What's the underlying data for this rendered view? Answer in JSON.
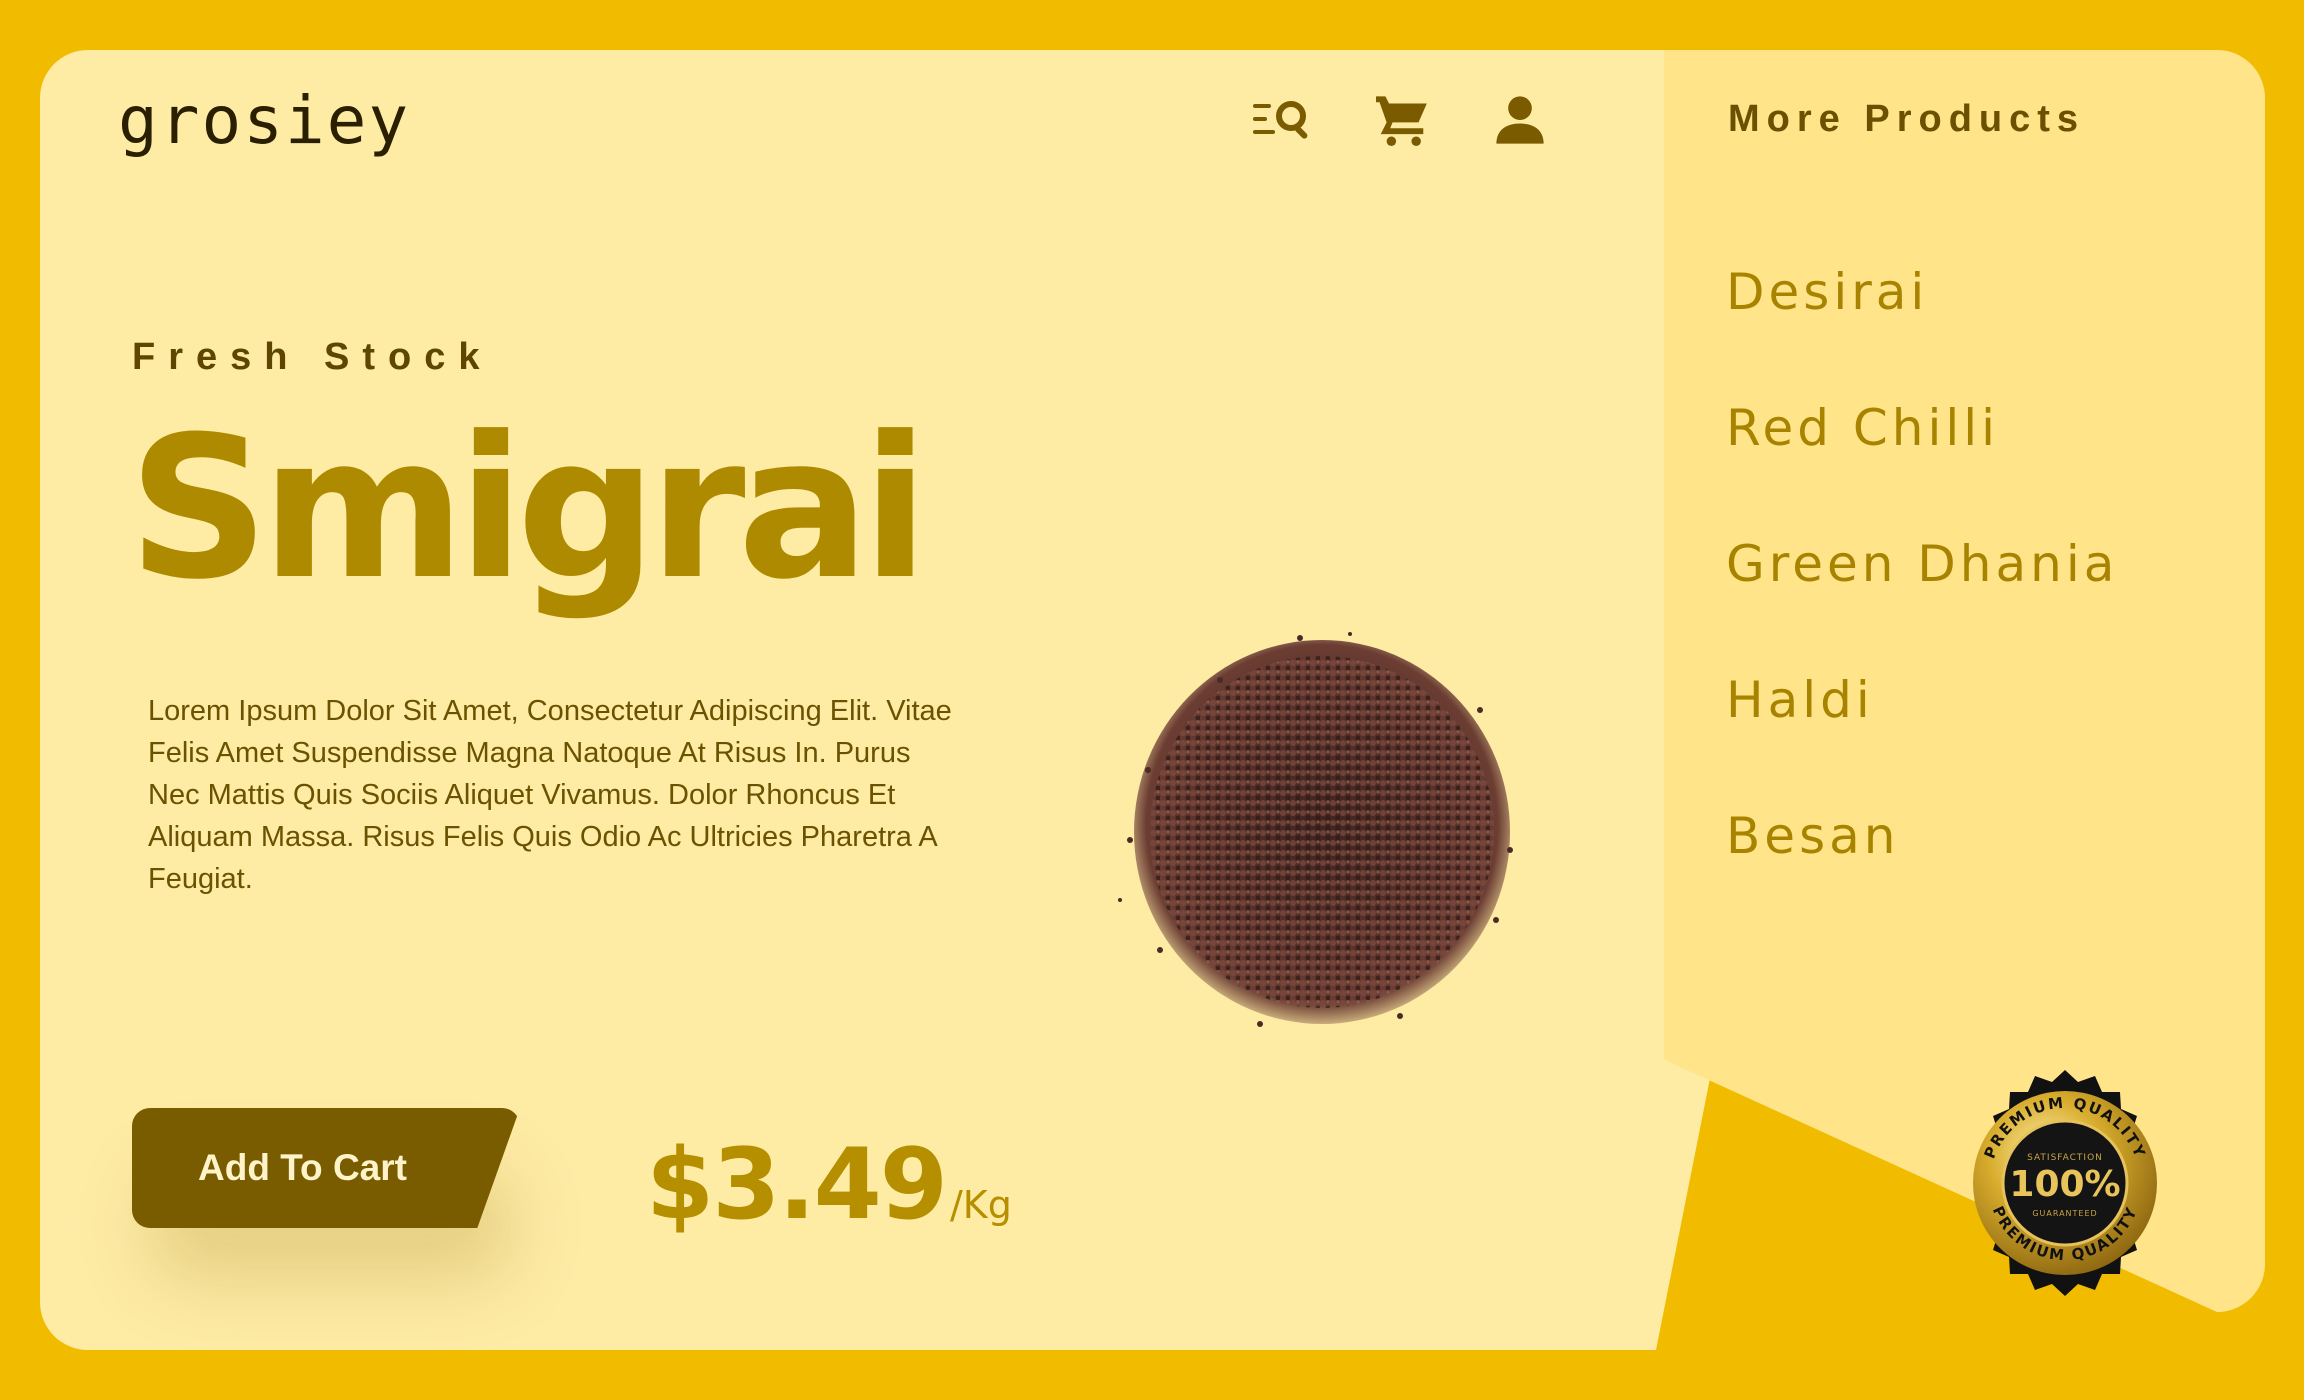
{
  "brand": {
    "logo": "grosiey"
  },
  "header": {
    "icons": [
      "search-menu-icon",
      "shopping-cart-icon",
      "user-icon"
    ]
  },
  "hero": {
    "eyebrow": "Fresh Stock",
    "title": "Smigrai",
    "description": "Lorem Ipsum Dolor Sit Amet, Consectetur Adipiscing Elit. Vitae Felis Amet Suspendisse Magna Natoque At Risus In. Purus Nec Mattis Quis Sociis Aliquet Vivamus. Dolor Rhoncus Et Aliquam Massa. Risus Felis Quis Odio Ac Ultricies Pharetra A Feugiat."
  },
  "cta": {
    "add_to_cart": "Add To Cart"
  },
  "price": {
    "amount": "$3.49",
    "unit": "/Kg"
  },
  "sidebar": {
    "title": "More Products",
    "items": [
      "Desirai",
      "Red Chilli",
      "Green Dhania",
      "Haldi",
      "Besan"
    ]
  },
  "badge": {
    "top_text": "PREMIUM QUALITY",
    "middle_text": "SATISFACTION",
    "value": "100%",
    "sub_text": "GUARANTEED",
    "bottom_text": "PREMIUM QUALITY"
  },
  "colors": {
    "background": "#F1BC00",
    "card": "#FEEBA4",
    "panel": "#FFE48A",
    "accent": "#AE8A00",
    "button": "#7A5C00"
  }
}
